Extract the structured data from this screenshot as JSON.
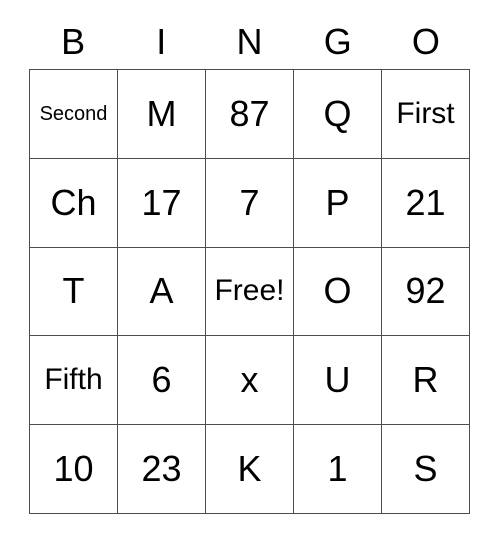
{
  "card": {
    "title": "BINGO",
    "headers": [
      "B",
      "I",
      "N",
      "G",
      "O"
    ],
    "free_space_label": "Free!",
    "colors": {
      "grid_line": "#4d4d4d",
      "text": "#000000",
      "background": "#ffffff"
    },
    "rows": [
      [
        {
          "text": "Second",
          "size": "small"
        },
        {
          "text": "M",
          "size": "large"
        },
        {
          "text": "87",
          "size": "large"
        },
        {
          "text": "Q",
          "size": "large"
        },
        {
          "text": "First",
          "size": "med"
        }
      ],
      [
        {
          "text": "Ch",
          "size": "large"
        },
        {
          "text": "17",
          "size": "large"
        },
        {
          "text": "7",
          "size": "large"
        },
        {
          "text": "P",
          "size": "large"
        },
        {
          "text": "21",
          "size": "large"
        }
      ],
      [
        {
          "text": "T",
          "size": "large"
        },
        {
          "text": "A",
          "size": "large"
        },
        {
          "text": "Free!",
          "size": "med"
        },
        {
          "text": "O",
          "size": "large"
        },
        {
          "text": "92",
          "size": "large"
        }
      ],
      [
        {
          "text": "Fifth",
          "size": "med"
        },
        {
          "text": "6",
          "size": "large"
        },
        {
          "text": "x",
          "size": "large"
        },
        {
          "text": "U",
          "size": "large"
        },
        {
          "text": "R",
          "size": "large"
        }
      ],
      [
        {
          "text": "10",
          "size": "large"
        },
        {
          "text": "23",
          "size": "large"
        },
        {
          "text": "K",
          "size": "large"
        },
        {
          "text": "1",
          "size": "large"
        },
        {
          "text": "S",
          "size": "large"
        }
      ]
    ]
  }
}
